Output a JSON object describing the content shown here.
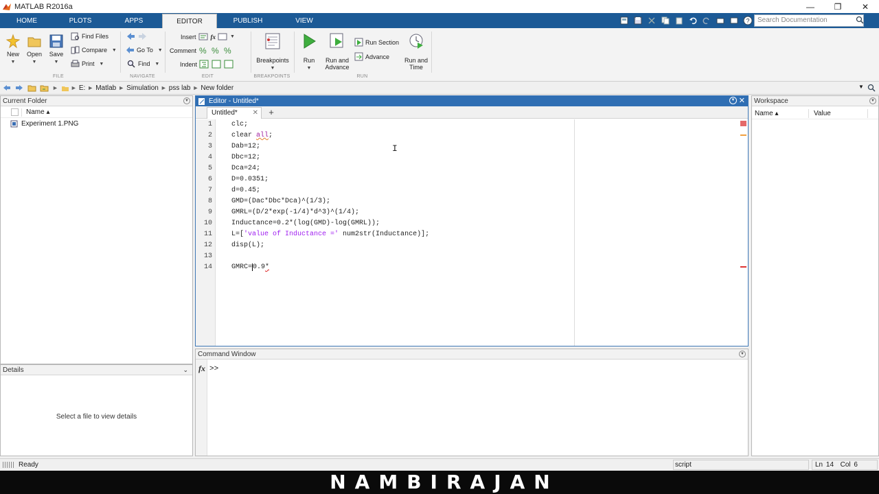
{
  "window": {
    "title": "MATLAB R2016a"
  },
  "ribbon": {
    "tabs": [
      {
        "label": "HOME"
      },
      {
        "label": "PLOTS"
      },
      {
        "label": "APPS"
      },
      {
        "label": "EDITOR"
      },
      {
        "label": "PUBLISH"
      },
      {
        "label": "VIEW"
      }
    ],
    "search_placeholder": "Search Documentation",
    "file": {
      "new": "New",
      "open": "Open",
      "save": "Save",
      "find_files": "Find Files",
      "compare": "Compare",
      "print": "Print",
      "section": "FILE"
    },
    "navigate": {
      "go_to": "Go To",
      "find": "Find",
      "section": "NAVIGATE"
    },
    "edit": {
      "insert": "Insert",
      "comment": "Comment",
      "indent": "Indent",
      "section": "EDIT"
    },
    "breakpoints": {
      "label": "Breakpoints",
      "section": "BREAKPOINTS"
    },
    "run": {
      "run": "Run",
      "run_and_advance_1": "Run and",
      "run_and_advance_2": "Advance",
      "run_section": "Run Section",
      "advance": "Advance",
      "run_and_time_1": "Run and",
      "run_and_time_2": "Time",
      "section": "RUN"
    }
  },
  "address": {
    "crumbs": [
      "E:",
      "Matlab",
      "Simulation",
      "pss lab",
      "New folder"
    ]
  },
  "current_folder": {
    "title": "Current Folder",
    "column_name": "Name ▴",
    "files": [
      {
        "name": "Experiment 1.PNG"
      }
    ]
  },
  "details": {
    "title": "Details",
    "empty_text": "Select a file to view details"
  },
  "editor": {
    "title": "Editor - Untitled*",
    "tab_label": "Untitled*",
    "lines": [
      {
        "n": "1",
        "code": "clc;"
      },
      {
        "n": "2",
        "code_a": "clear ",
        "code_kw": "all",
        "code_b": ";"
      },
      {
        "n": "3",
        "code": "Dab=12;"
      },
      {
        "n": "4",
        "code": "Dbc=12;"
      },
      {
        "n": "5",
        "code": "Dca=24;"
      },
      {
        "n": "6",
        "code": "D=0.0351;"
      },
      {
        "n": "7",
        "code": "d=0.45;"
      },
      {
        "n": "8",
        "code": "GMD=(Dac*Dbc*Dca)^(1/3);"
      },
      {
        "n": "9",
        "code": "GMRL=(D/2*exp(-1/4)*d^3)^(1/4);"
      },
      {
        "n": "10",
        "code": "Inductance=0.2*(log(GMD)-log(GMRL));"
      },
      {
        "n": "11",
        "code_a": "L=[",
        "code_str": "'value of Inductance ='",
        "code_b": " num2str(Inductance)];"
      },
      {
        "n": "12",
        "code": "disp(L);"
      },
      {
        "n": "13",
        "code": ""
      },
      {
        "n": "14",
        "code_a": "GMRC=",
        "code_b": "0.9",
        "code_err": "*"
      }
    ]
  },
  "command_window": {
    "title": "Command Window",
    "fx": "fx",
    "prompt": ">>"
  },
  "workspace": {
    "title": "Workspace",
    "col_name": "Name ▴",
    "col_value": "Value"
  },
  "status": {
    "ready": "Ready",
    "mode": "script",
    "ln_label": "Ln",
    "ln": "14",
    "col_label": "Col",
    "col": "6"
  },
  "watermark": "NAMBIRAJAN",
  "colors": {
    "ribbon_blue": "#1c5a96",
    "editor_header": "#2f6eb3",
    "string": "#a020f0",
    "keyword": "#a0219f"
  }
}
